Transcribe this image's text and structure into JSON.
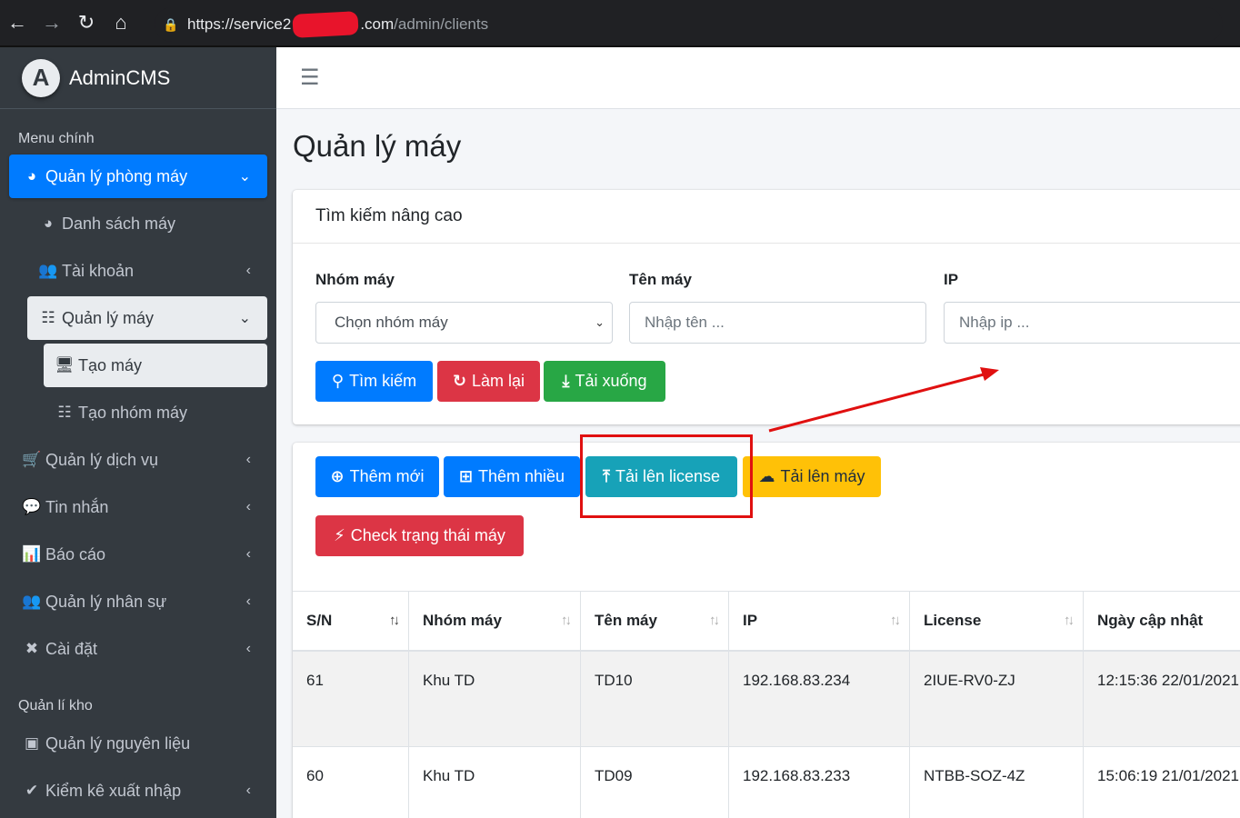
{
  "browser": {
    "url_host": "https://service2",
    "url_domain_end": ".com",
    "url_path": "/admin/clients",
    "icons": [
      "back-arrow-icon",
      "forward-arrow-icon",
      "reload-icon",
      "home-icon",
      "lock-icon"
    ]
  },
  "sidebar": {
    "brand_initial": "A",
    "brand_prefix": "Admin",
    "brand_suffix": "CMS",
    "section_main": "Menu chính",
    "items_main": [
      {
        "label": "Quản lý phòng máy",
        "icon": "tachometer-icon"
      },
      {
        "label": "Danh sách máy",
        "icon": "tachometer-icon"
      },
      {
        "label": "Tài khoản",
        "icon": "users-icon"
      },
      {
        "label": "Quản lý máy",
        "icon": "sitemap-icon"
      },
      {
        "label": "Tạo máy",
        "icon": "desktop-icon"
      },
      {
        "label": "Tạo nhóm máy",
        "icon": "sitemap-icon"
      },
      {
        "label": "Quản lý dịch vụ",
        "icon": "cart-icon"
      },
      {
        "label": "Tin nhắn",
        "icon": "comments-icon"
      },
      {
        "label": "Báo cáo",
        "icon": "bar-chart-icon"
      },
      {
        "label": "Quản lý nhân sự",
        "icon": "users-group-icon"
      },
      {
        "label": "Cài đặt",
        "icon": "tools-icon"
      }
    ],
    "section_store": "Quản lí kho",
    "items_store": [
      {
        "label": "Quản lý nguyên liệu",
        "icon": "box-icon"
      },
      {
        "label": "Kiểm kê xuất nhập",
        "icon": "check-icon"
      }
    ]
  },
  "header": {
    "menu_icon": "hamburger-icon"
  },
  "page": {
    "title": "Quản lý máy"
  },
  "search": {
    "card_title": "Tìm kiếm nâng cao",
    "group_label": "Nhóm máy",
    "group_value": "Chọn nhóm máy",
    "name_label": "Tên máy",
    "name_placeholder": "Nhập tên ...",
    "ip_label": "IP",
    "ip_placeholder": "Nhập ip ...",
    "btn_search": "Tìm kiếm",
    "btn_reset": "Làm lại",
    "btn_download": "Tải xuống"
  },
  "actions": {
    "btn_add": "Thêm mới",
    "btn_add_many": "Thêm nhiều",
    "btn_upload_license": "Tải lên license",
    "btn_upload_machine": "Tải lên máy",
    "btn_check_status": "Check trạng thái máy"
  },
  "table": {
    "columns": [
      "S/N",
      "Nhóm máy",
      "Tên máy",
      "IP",
      "License",
      "Ngày cập nhật"
    ],
    "rows": [
      [
        "61",
        "Khu TD",
        "TD10",
        "192.168.83.234",
        "2IUE-RV0-ZJ",
        "12:15:36 22/01/2021"
      ],
      [
        "60",
        "Khu TD",
        "TD09",
        "192.168.83.233",
        "NTBB-SOZ-4Z",
        "15:06:19 21/01/2021"
      ]
    ]
  },
  "colors": {
    "primary": "#007bff",
    "danger": "#dc3545",
    "success": "#28a745",
    "info": "#17a2b8",
    "warning": "#ffc107",
    "annotation": "#e01010",
    "sidebar": "#343a40"
  }
}
